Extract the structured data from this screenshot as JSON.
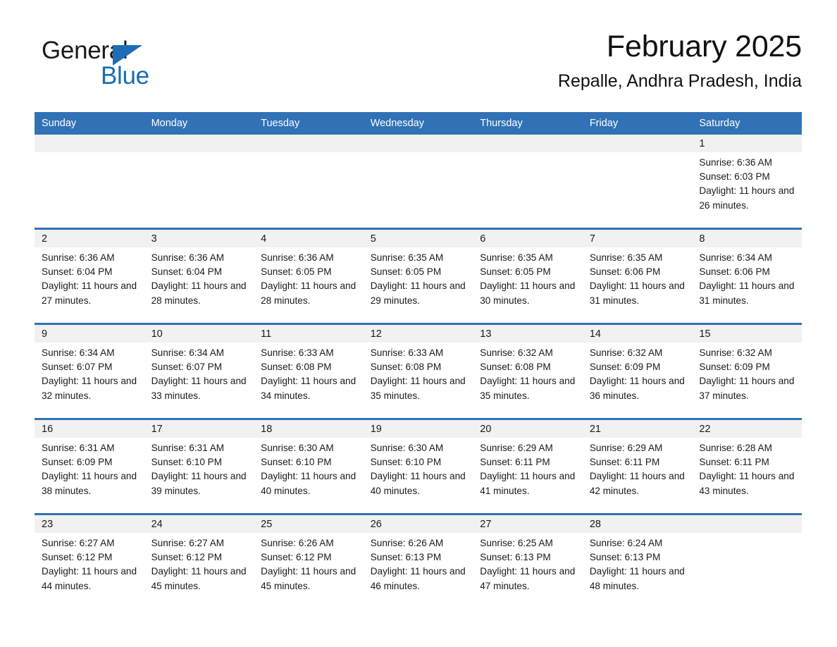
{
  "brand": {
    "line1": "General",
    "line2": "Blue",
    "icon": "triangle-logo"
  },
  "header": {
    "month_title": "February 2025",
    "location": "Repalle, Andhra Pradesh, India"
  },
  "colors": {
    "header_blue": "#3072b5",
    "brand_blue": "#1a6cb4",
    "daynum_band": "#f1f1f1"
  },
  "weekdays": [
    "Sunday",
    "Monday",
    "Tuesday",
    "Wednesday",
    "Thursday",
    "Friday",
    "Saturday"
  ],
  "weeks": [
    [
      {
        "empty": true
      },
      {
        "empty": true
      },
      {
        "empty": true
      },
      {
        "empty": true
      },
      {
        "empty": true
      },
      {
        "empty": true
      },
      {
        "day": "1",
        "sunrise": "Sunrise: 6:36 AM",
        "sunset": "Sunset: 6:03 PM",
        "daylight": "Daylight: 11 hours and 26 minutes."
      }
    ],
    [
      {
        "day": "2",
        "sunrise": "Sunrise: 6:36 AM",
        "sunset": "Sunset: 6:04 PM",
        "daylight": "Daylight: 11 hours and 27 minutes."
      },
      {
        "day": "3",
        "sunrise": "Sunrise: 6:36 AM",
        "sunset": "Sunset: 6:04 PM",
        "daylight": "Daylight: 11 hours and 28 minutes."
      },
      {
        "day": "4",
        "sunrise": "Sunrise: 6:36 AM",
        "sunset": "Sunset: 6:05 PM",
        "daylight": "Daylight: 11 hours and 28 minutes."
      },
      {
        "day": "5",
        "sunrise": "Sunrise: 6:35 AM",
        "sunset": "Sunset: 6:05 PM",
        "daylight": "Daylight: 11 hours and 29 minutes."
      },
      {
        "day": "6",
        "sunrise": "Sunrise: 6:35 AM",
        "sunset": "Sunset: 6:05 PM",
        "daylight": "Daylight: 11 hours and 30 minutes."
      },
      {
        "day": "7",
        "sunrise": "Sunrise: 6:35 AM",
        "sunset": "Sunset: 6:06 PM",
        "daylight": "Daylight: 11 hours and 31 minutes."
      },
      {
        "day": "8",
        "sunrise": "Sunrise: 6:34 AM",
        "sunset": "Sunset: 6:06 PM",
        "daylight": "Daylight: 11 hours and 31 minutes."
      }
    ],
    [
      {
        "day": "9",
        "sunrise": "Sunrise: 6:34 AM",
        "sunset": "Sunset: 6:07 PM",
        "daylight": "Daylight: 11 hours and 32 minutes."
      },
      {
        "day": "10",
        "sunrise": "Sunrise: 6:34 AM",
        "sunset": "Sunset: 6:07 PM",
        "daylight": "Daylight: 11 hours and 33 minutes."
      },
      {
        "day": "11",
        "sunrise": "Sunrise: 6:33 AM",
        "sunset": "Sunset: 6:08 PM",
        "daylight": "Daylight: 11 hours and 34 minutes."
      },
      {
        "day": "12",
        "sunrise": "Sunrise: 6:33 AM",
        "sunset": "Sunset: 6:08 PM",
        "daylight": "Daylight: 11 hours and 35 minutes."
      },
      {
        "day": "13",
        "sunrise": "Sunrise: 6:32 AM",
        "sunset": "Sunset: 6:08 PM",
        "daylight": "Daylight: 11 hours and 35 minutes."
      },
      {
        "day": "14",
        "sunrise": "Sunrise: 6:32 AM",
        "sunset": "Sunset: 6:09 PM",
        "daylight": "Daylight: 11 hours and 36 minutes."
      },
      {
        "day": "15",
        "sunrise": "Sunrise: 6:32 AM",
        "sunset": "Sunset: 6:09 PM",
        "daylight": "Daylight: 11 hours and 37 minutes."
      }
    ],
    [
      {
        "day": "16",
        "sunrise": "Sunrise: 6:31 AM",
        "sunset": "Sunset: 6:09 PM",
        "daylight": "Daylight: 11 hours and 38 minutes."
      },
      {
        "day": "17",
        "sunrise": "Sunrise: 6:31 AM",
        "sunset": "Sunset: 6:10 PM",
        "daylight": "Daylight: 11 hours and 39 minutes."
      },
      {
        "day": "18",
        "sunrise": "Sunrise: 6:30 AM",
        "sunset": "Sunset: 6:10 PM",
        "daylight": "Daylight: 11 hours and 40 minutes."
      },
      {
        "day": "19",
        "sunrise": "Sunrise: 6:30 AM",
        "sunset": "Sunset: 6:10 PM",
        "daylight": "Daylight: 11 hours and 40 minutes."
      },
      {
        "day": "20",
        "sunrise": "Sunrise: 6:29 AM",
        "sunset": "Sunset: 6:11 PM",
        "daylight": "Daylight: 11 hours and 41 minutes."
      },
      {
        "day": "21",
        "sunrise": "Sunrise: 6:29 AM",
        "sunset": "Sunset: 6:11 PM",
        "daylight": "Daylight: 11 hours and 42 minutes."
      },
      {
        "day": "22",
        "sunrise": "Sunrise: 6:28 AM",
        "sunset": "Sunset: 6:11 PM",
        "daylight": "Daylight: 11 hours and 43 minutes."
      }
    ],
    [
      {
        "day": "23",
        "sunrise": "Sunrise: 6:27 AM",
        "sunset": "Sunset: 6:12 PM",
        "daylight": "Daylight: 11 hours and 44 minutes."
      },
      {
        "day": "24",
        "sunrise": "Sunrise: 6:27 AM",
        "sunset": "Sunset: 6:12 PM",
        "daylight": "Daylight: 11 hours and 45 minutes."
      },
      {
        "day": "25",
        "sunrise": "Sunrise: 6:26 AM",
        "sunset": "Sunset: 6:12 PM",
        "daylight": "Daylight: 11 hours and 45 minutes."
      },
      {
        "day": "26",
        "sunrise": "Sunrise: 6:26 AM",
        "sunset": "Sunset: 6:13 PM",
        "daylight": "Daylight: 11 hours and 46 minutes."
      },
      {
        "day": "27",
        "sunrise": "Sunrise: 6:25 AM",
        "sunset": "Sunset: 6:13 PM",
        "daylight": "Daylight: 11 hours and 47 minutes."
      },
      {
        "day": "28",
        "sunrise": "Sunrise: 6:24 AM",
        "sunset": "Sunset: 6:13 PM",
        "daylight": "Daylight: 11 hours and 48 minutes."
      },
      {
        "empty": true
      }
    ]
  ]
}
